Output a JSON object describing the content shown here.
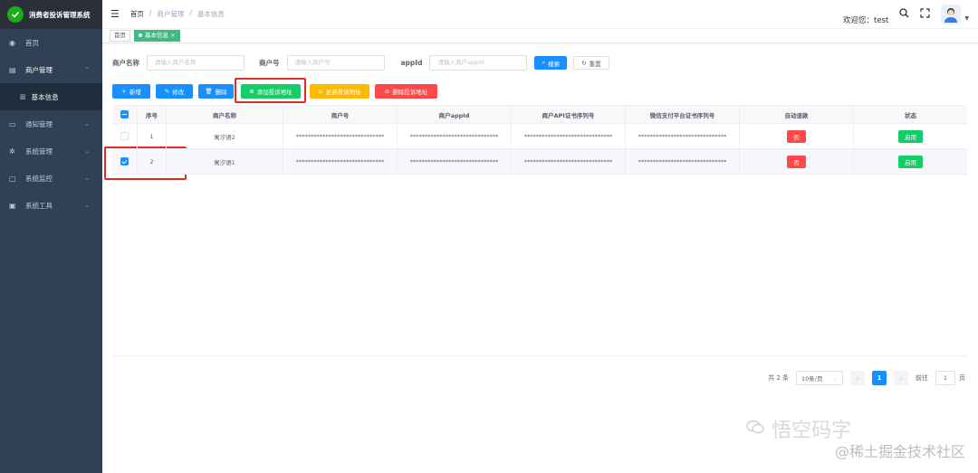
{
  "app": {
    "title": "消费者投诉管理系统"
  },
  "sidebar": {
    "items": [
      {
        "label": "首页",
        "icon": "dashboard-icon"
      },
      {
        "label": "商户管理",
        "icon": "shop-icon"
      },
      {
        "label": "通知管理",
        "icon": "message-icon"
      },
      {
        "label": "系统管理",
        "icon": "gear-icon"
      },
      {
        "label": "系统监控",
        "icon": "monitor-icon"
      },
      {
        "label": "系统工具",
        "icon": "tool-icon"
      }
    ],
    "submenu": {
      "label": "基本信息",
      "icon": "list-icon"
    }
  },
  "header": {
    "breadcrumb": [
      "首页",
      "商户管理",
      "基本信息"
    ],
    "welcome": "欢迎您：test"
  },
  "tags": {
    "home": "首页",
    "active": "基本信息",
    "close": "×"
  },
  "search": {
    "merchant_name_label": "商户名称",
    "merchant_name_placeholder": "请输入商户名称",
    "merchant_no_label": "商户号",
    "merchant_no_placeholder": "请输入商户号",
    "appid_label": "appId",
    "appid_placeholder": "请输入商户appId",
    "search_button": "搜索",
    "reset_button": "重置"
  },
  "toolbar": {
    "add": "新增",
    "edit": "修改",
    "delete": "删除",
    "add_complaint_url": "添加投诉地址",
    "update_complaint_url": "更新投诉地址",
    "delete_complaint_url": "删除投诉地址"
  },
  "table": {
    "headers": [
      "序号",
      "商户名称",
      "商户号",
      "商户appId",
      "商户API证书序列号",
      "微信支付平台证书序列号",
      "自动退款",
      "状态"
    ],
    "rows": [
      {
        "index": "1",
        "name": "寓汐语2",
        "merchant_no": "******************************",
        "appid": "******************************",
        "api_cert": "******************************",
        "platform_cert": "******************************",
        "refund": "否",
        "status": "启用",
        "checked": false
      },
      {
        "index": "2",
        "name": "寓汐语1",
        "merchant_no": "******************************",
        "appid": "******************************",
        "api_cert": "******************************",
        "platform_cert": "******************************",
        "refund": "否",
        "status": "启用",
        "checked": true
      }
    ]
  },
  "pagination": {
    "total": "共 2 条",
    "page_size": "10条/页",
    "current_page": "1",
    "goto_label": "前往",
    "goto_value": "1",
    "page_unit": "页"
  },
  "watermark": {
    "line1": "悟空码字",
    "line2": "@稀土掘金技术社区"
  },
  "colors": {
    "sidebar": "#304156",
    "primary": "#1890ff",
    "success": "#13ce66",
    "warning": "#ffba00",
    "danger": "#ff4949",
    "highlight": "#e02b20"
  }
}
